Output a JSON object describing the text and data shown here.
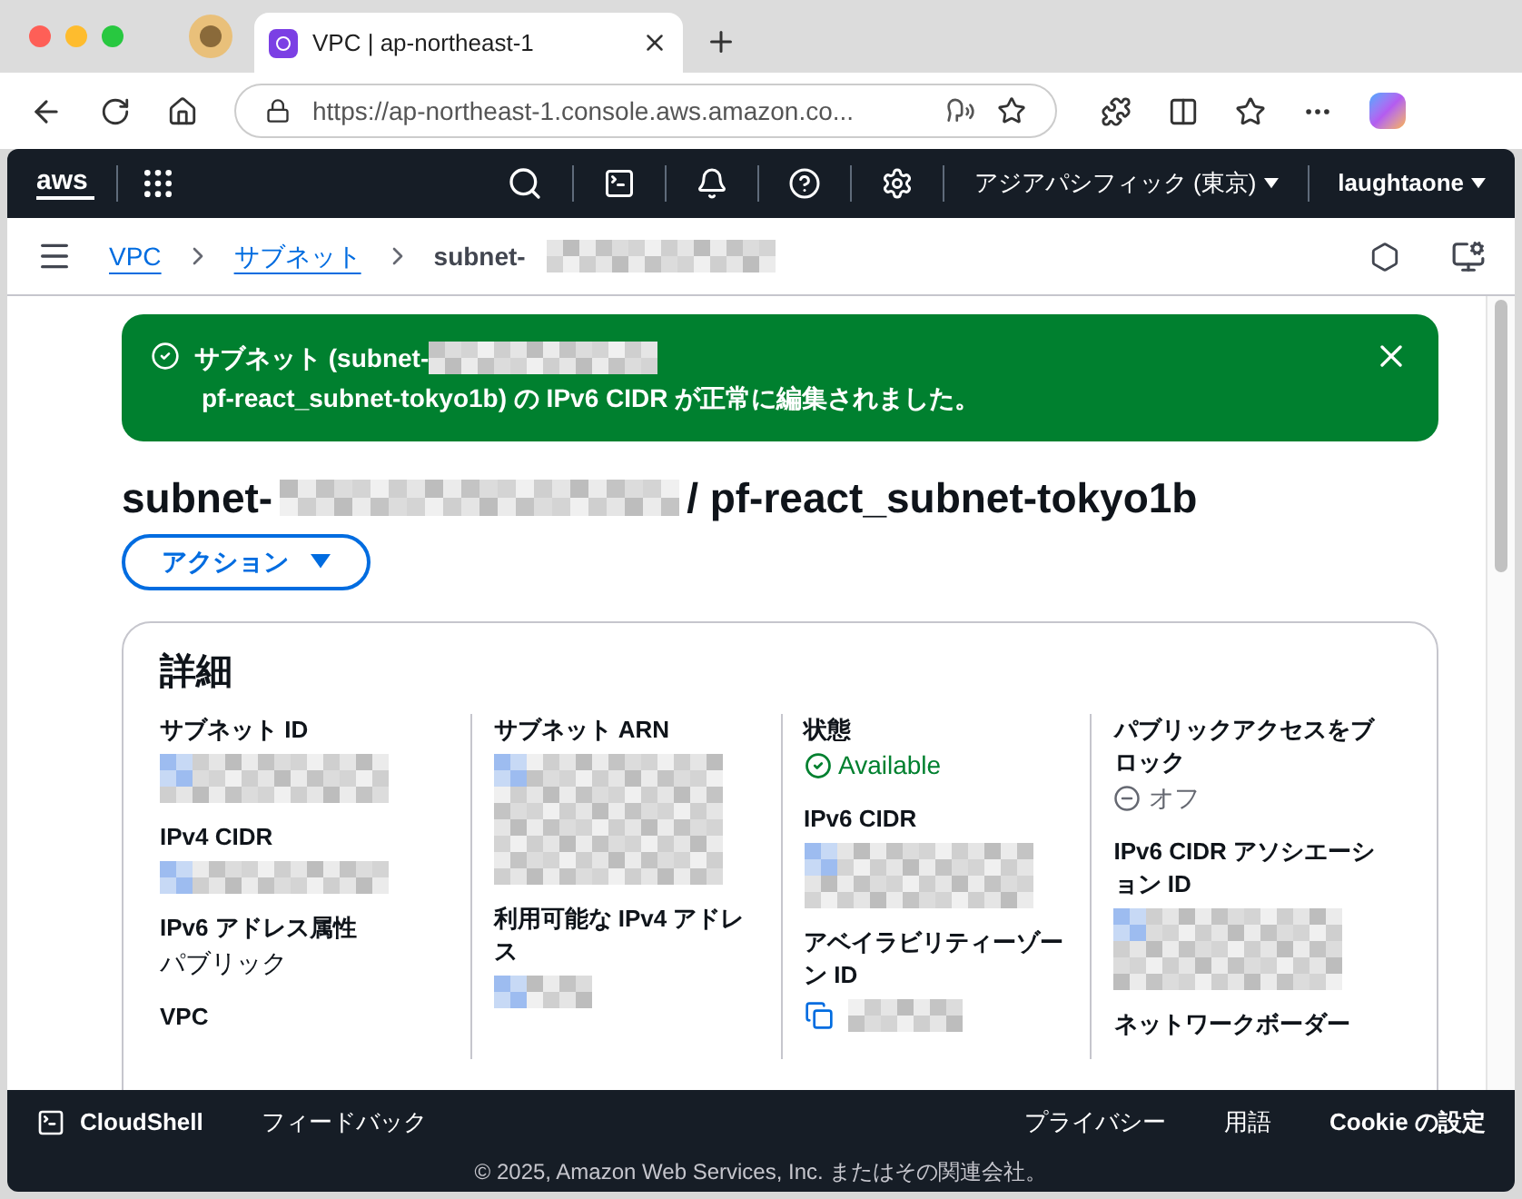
{
  "browser": {
    "tab_title": "VPC | ap-northeast-1",
    "url": "https://ap-northeast-1.console.aws.amazon.co..."
  },
  "topnav": {
    "logo": "aws",
    "region": "アジアパシフィック (東京)",
    "user": "laughtaone"
  },
  "breadcrumbs": [
    {
      "label": "VPC",
      "link": true
    },
    {
      "label": "サブネット",
      "link": true
    },
    {
      "label": "subnet-",
      "link": false
    }
  ],
  "flash": {
    "text_before": "サブネット (subnet-",
    "text_after": "pf-react_subnet-tokyo1b) の IPv6 CIDR が正常に編集されました。"
  },
  "title": {
    "prefix": "subnet-",
    "suffix": "/ pf-react_subnet-tokyo1b"
  },
  "actions_button": "アクション",
  "details": {
    "title": "詳細",
    "columns": [
      [
        {
          "label": "サブネット ID",
          "kind": "redacted"
        },
        {
          "label": "IPv4 CIDR",
          "kind": "redacted"
        },
        {
          "label": "IPv6 アドレス属性",
          "kind": "text",
          "value": "パブリック"
        },
        {
          "label": "VPC",
          "kind": "none"
        }
      ],
      [
        {
          "label": "サブネット ARN",
          "kind": "redacted"
        },
        {
          "label": "利用可能な IPv4 アドレス",
          "kind": "redacted"
        }
      ],
      [
        {
          "label": "状態",
          "kind": "status",
          "value": "Available"
        },
        {
          "label": "IPv6 CIDR",
          "kind": "redacted"
        },
        {
          "label": "アベイラビリティーゾーン ID",
          "kind": "copy"
        }
      ],
      [
        {
          "label": "パブリックアクセスをブロック",
          "kind": "off",
          "value": "オフ"
        },
        {
          "label": "IPv6 CIDR アソシエーション ID",
          "kind": "redacted"
        },
        {
          "label": "ネットワークボーダー",
          "kind": "none"
        }
      ]
    ]
  },
  "footer": {
    "cloudshell": "CloudShell",
    "feedback": "フィードバック",
    "links": [
      "プライバシー",
      "用語",
      "Cookie の設定"
    ],
    "copyright": "© 2025, Amazon Web Services, Inc. またはその関連会社。"
  }
}
